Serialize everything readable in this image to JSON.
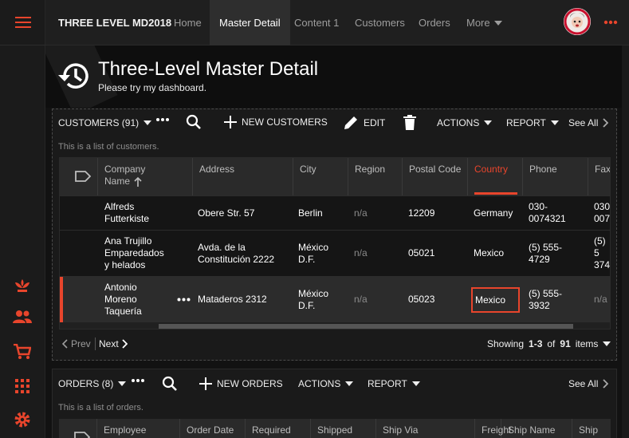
{
  "brand": "THREE LEVEL MD2018",
  "nav": {
    "home": "Home",
    "master_detail": "Master Detail",
    "content1": "Content 1",
    "customers": "Customers",
    "orders": "Orders",
    "more": "More"
  },
  "header": {
    "title": "Three-Level Master Detail",
    "subtitle": "Please try my dashboard."
  },
  "customers": {
    "title": "CUSTOMERS (91)",
    "new_label": "NEW CUSTOMERS",
    "edit_label": "EDIT",
    "actions_label": "ACTIONS",
    "report_label": "REPORT",
    "see_all": "See All",
    "note": "This is a list of customers.",
    "columns": {
      "company_line1": "Company",
      "company_line2": "Name",
      "address": "Address",
      "city": "City",
      "region": "Region",
      "postal": "Postal Code",
      "country": "Country",
      "phone": "Phone",
      "fax": "Fax"
    },
    "rows": [
      {
        "company": [
          "Alfreds",
          "Futterkiste"
        ],
        "address": [
          "Obere Str. 57"
        ],
        "city": [
          "Berlin"
        ],
        "region": "n/a",
        "postal": "12209",
        "country": "Germany",
        "phone": [
          "030-",
          "0074321"
        ],
        "fax": [
          "030",
          "007"
        ]
      },
      {
        "company": [
          "Ana Trujillo",
          "Emparedados",
          "y helados"
        ],
        "address": [
          "Avda. de la",
          "Constitución 2222"
        ],
        "city": [
          "México",
          "D.F."
        ],
        "region": "n/a",
        "postal": "05021",
        "country": "Mexico",
        "phone": [
          "(5) 555-",
          "4729"
        ],
        "fax": [
          "(5) 5",
          "374"
        ]
      },
      {
        "company": [
          "Antonio",
          "Moreno",
          "Taquería"
        ],
        "address": [
          "Mataderos 2312"
        ],
        "city": [
          "México",
          "D.F."
        ],
        "region": "n/a",
        "postal": "05023",
        "country": "Mexico",
        "phone": [
          "(5) 555-",
          "3932"
        ],
        "fax": [
          "n/a"
        ]
      }
    ],
    "prev": "Prev",
    "next": "Next",
    "showing_prefix": "Showing",
    "showing_range": "1-3",
    "showing_of": "of",
    "showing_total": "91",
    "showing_suffix": "items"
  },
  "orders": {
    "title": "ORDERS (8)",
    "new_label": "NEW ORDERS",
    "actions_label": "ACTIONS",
    "report_label": "REPORT",
    "see_all": "See All",
    "note": "This is a list of orders.",
    "columns": {
      "employee": "Employee",
      "order_date": "Order Date",
      "required": "Required",
      "shipped": "Shipped",
      "ship_via": "Ship Via",
      "freight": "Freight",
      "ship_name": "Ship Name",
      "ship_address": "Ship Ac"
    }
  },
  "colors": {
    "accent": "#e8452c",
    "background": "#121212",
    "panel": "#1a1a1a"
  },
  "icons": {
    "menu": "hamburger-icon",
    "history": "history-icon",
    "search": "search-icon",
    "add": "plus-icon",
    "edit": "pencil-icon",
    "delete": "trash-icon",
    "more": "dots-icon",
    "sidebar": [
      "flower-icon",
      "users-icon",
      "cart-icon",
      "grid-icon",
      "gear-icon"
    ]
  }
}
